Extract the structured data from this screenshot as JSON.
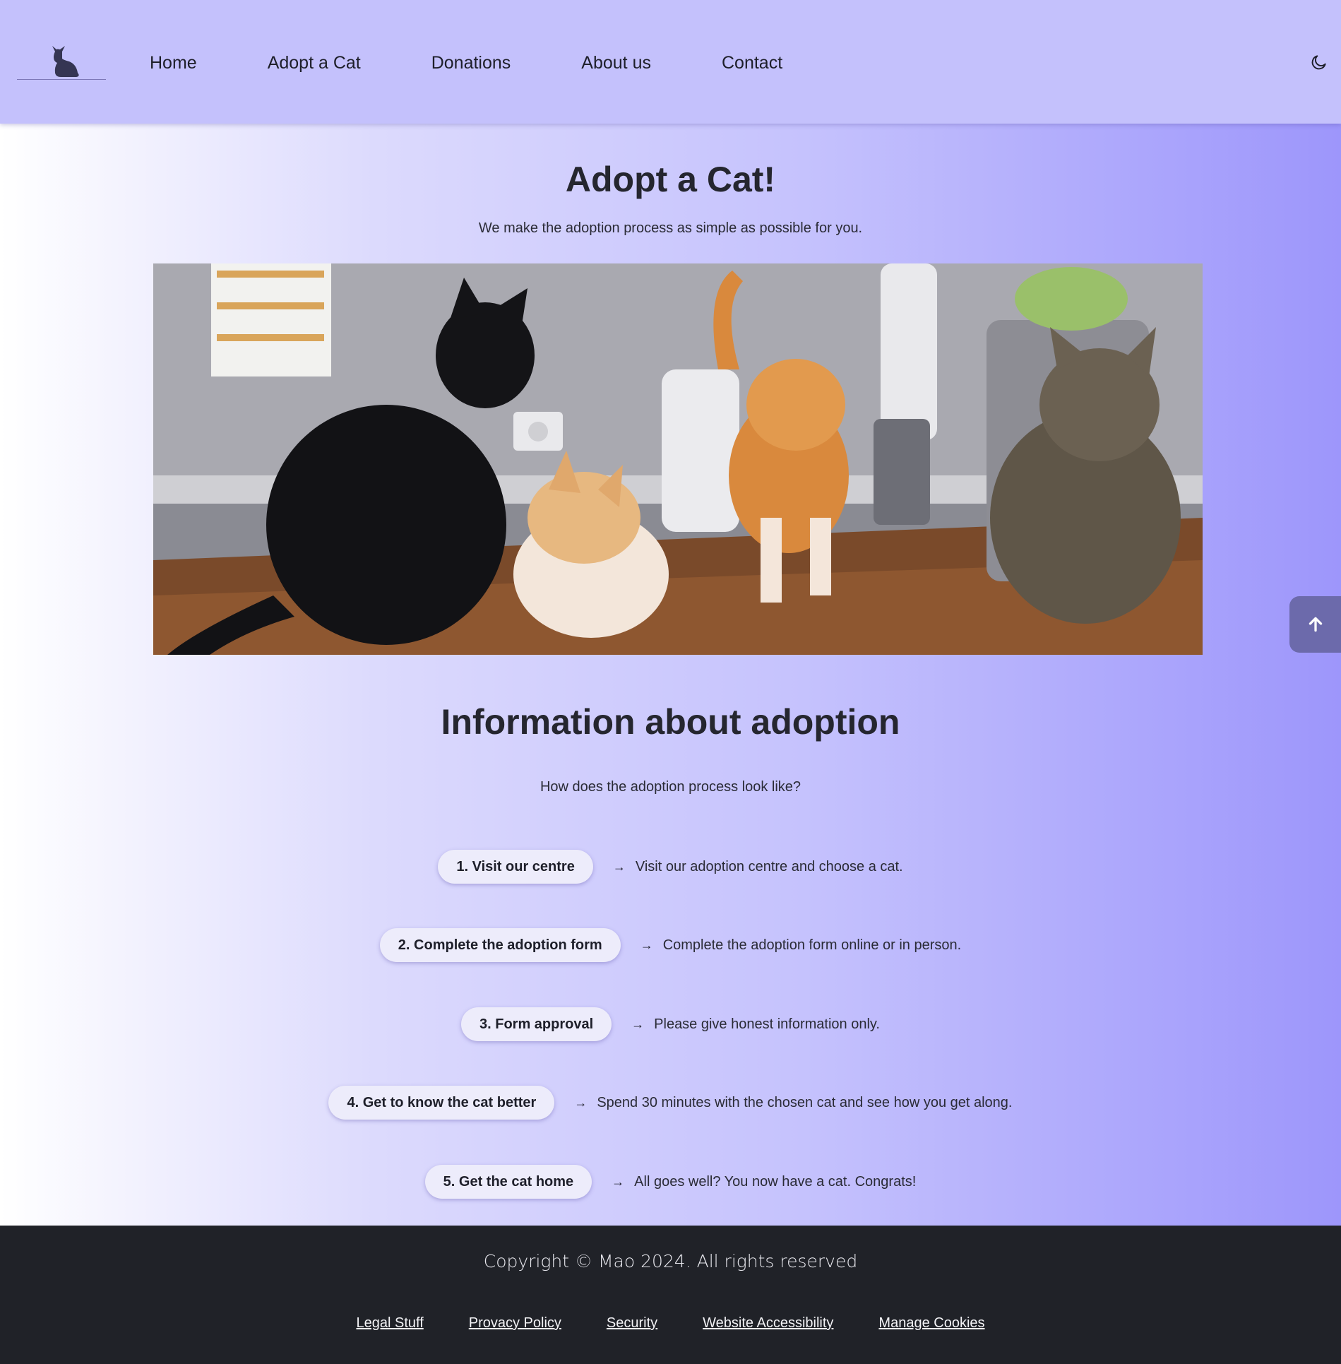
{
  "header": {
    "logo_icon": "cat-logo-icon",
    "nav": [
      {
        "label": "Home"
      },
      {
        "label": "Adopt a Cat"
      },
      {
        "label": "Donations"
      },
      {
        "label": "About us"
      },
      {
        "label": "Contact"
      }
    ],
    "theme_icon": "moon-icon"
  },
  "hero": {
    "title": "Adopt a Cat!",
    "subtitle": "We make the adoption process as simple as possible for you."
  },
  "info": {
    "title": "Information about adoption",
    "subtitle": "How does the adoption process look like?",
    "steps": [
      {
        "label": "1. Visit our centre",
        "description": "Visit our adoption centre and choose a cat."
      },
      {
        "label": "2. Complete the adoption form",
        "description": "Complete the adoption form online or in person."
      },
      {
        "label": "3. Form approval",
        "description": "Please give honest information only."
      },
      {
        "label": "4. Get to know the cat better",
        "description": "Spend 30 minutes with the chosen cat and see how you get along."
      },
      {
        "label": "5. Get the cat home",
        "description": "All goes well? You now have a cat. Congrats!"
      }
    ]
  },
  "back_to_top_icon": "arrow-up-icon",
  "footer": {
    "copyright": "Copyright © Mao 2024. All rights reserved",
    "links": [
      {
        "label": "Legal Stuff"
      },
      {
        "label": "Provacy Policy"
      },
      {
        "label": "Security"
      },
      {
        "label": "Website Accessibility"
      },
      {
        "label": "Manage Cookies"
      }
    ]
  },
  "colors": {
    "header_bg": "#c4c1fc",
    "footer_bg": "#202228",
    "pill_bg": "#edecfb",
    "back_top_bg": "#6c6aab"
  }
}
